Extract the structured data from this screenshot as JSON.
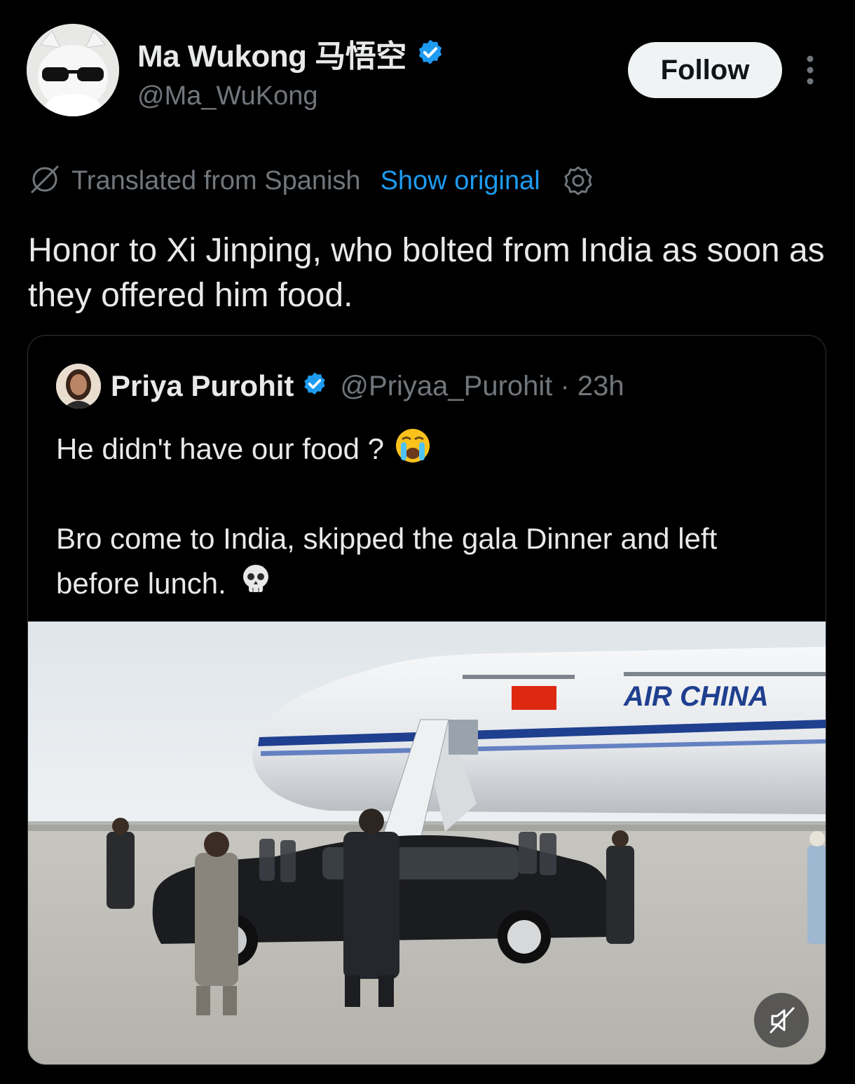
{
  "author": {
    "display_name": "Ma Wukong 马悟空",
    "handle": "@Ma_WuKong",
    "verified": true
  },
  "actions": {
    "follow_label": "Follow"
  },
  "translation": {
    "label": "Translated from Spanish",
    "show_original_label": "Show original"
  },
  "tweet": {
    "text": "Honor to Xi Jinping, who bolted from India as soon as they offered him food."
  },
  "quoted": {
    "display_name": "Priya Purohit",
    "handle_time": "@Priyaa_Purohit · 23h",
    "line1": "He didn't have our food ?",
    "line2": "Bro come to India, skipped the gala Dinner and left before lunch.",
    "emoji1": "crying-face-emoji",
    "emoji2": "skull-emoji"
  },
  "media": {
    "aircraft_livery_text": "AIR CHINA",
    "muted": true
  },
  "colors": {
    "background": "#000000",
    "text": "#e7e9ea",
    "secondary": "#71767b",
    "accent": "#1d9bf0",
    "border": "#2f3336"
  }
}
